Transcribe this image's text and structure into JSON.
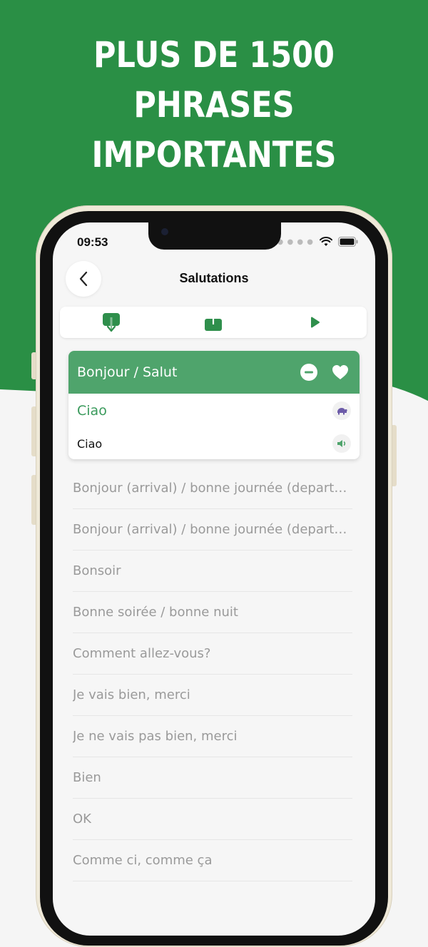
{
  "headline": [
    "PLUS DE 1500",
    "PHRASES",
    "IMPORTANTES"
  ],
  "status_bar": {
    "time": "09:53"
  },
  "header": {
    "title": "Salutations"
  },
  "toolbar": {
    "buttons": [
      {
        "icon": "download-icon"
      },
      {
        "icon": "share-icon"
      },
      {
        "icon": "play-icon"
      }
    ]
  },
  "expanded_phrase": {
    "title": "Bonjour / Salut",
    "translation": "Ciao",
    "pronunciation": "Ciao"
  },
  "phrases": [
    "Bonjour (arrival) / bonne journée (departure)",
    "Bonjour (arrival) / bonne journée (departure)",
    "Bonsoir",
    "Bonne soirée / bonne nuit",
    "Comment allez-vous?",
    "Je vais bien, merci",
    "Je ne vais pas bien, merci",
    "Bien",
    "OK",
    "Comme ci, comme ça"
  ],
  "colors": {
    "brand_green": "#2a8f45",
    "header_green": "#4fa46c",
    "accent_green": "#3a9a5c",
    "muted_text": "#9a9a9a"
  }
}
